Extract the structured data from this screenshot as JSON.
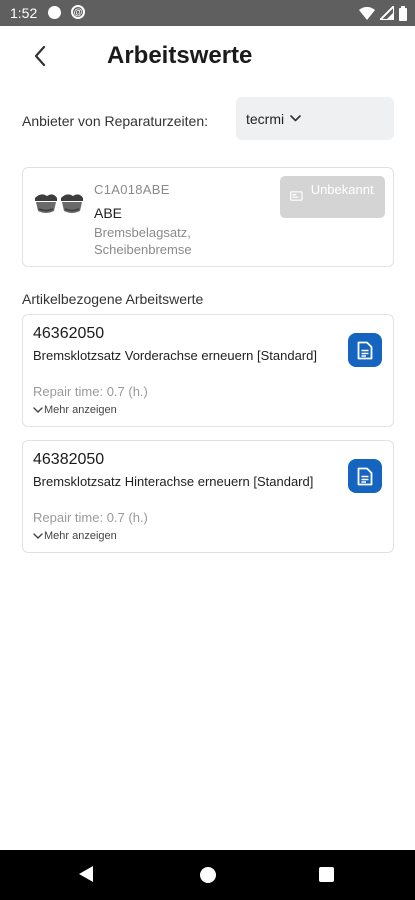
{
  "status_bar": {
    "time": "1:52",
    "icons": [
      "notification-dot-icon",
      "at-icon",
      "wifi-icon",
      "signal-icon",
      "battery-icon"
    ]
  },
  "header": {
    "title": "Arbeitswerte",
    "back_icon": "chevron-left-icon"
  },
  "provider": {
    "label": "Anbieter von Reparaturzeiten:",
    "selected": "tecrmi",
    "icon": "chevron-down-icon"
  },
  "part": {
    "number": "C1A018ABE",
    "brand": "ABE",
    "description": "Bremsbelagsatz, Scheibenbremse",
    "status_label": "Unbekannt",
    "icon": "brake-pad-icon"
  },
  "section_title": "Artikelbezogene Arbeitswerte",
  "work_items": [
    {
      "number": "46362050",
      "description": "Bremsklotzsatz Vorderachse erneuern [Standard]",
      "repair_time": "Repair time: 0.7 (h.)",
      "more_label": "Mehr anzeigen",
      "icon": "document-icon"
    },
    {
      "number": "46382050",
      "description": "Bremsklotzsatz Hinterachse erneuern [Standard]",
      "repair_time": "Repair time: 0.7 (h.)",
      "more_label": "Mehr anzeigen",
      "icon": "document-icon"
    }
  ],
  "colors": {
    "accent": "#1565c0",
    "status_bar": "#5f5f5f",
    "disabled_button": "#d4d4d4",
    "select_background": "#eef0f2"
  }
}
